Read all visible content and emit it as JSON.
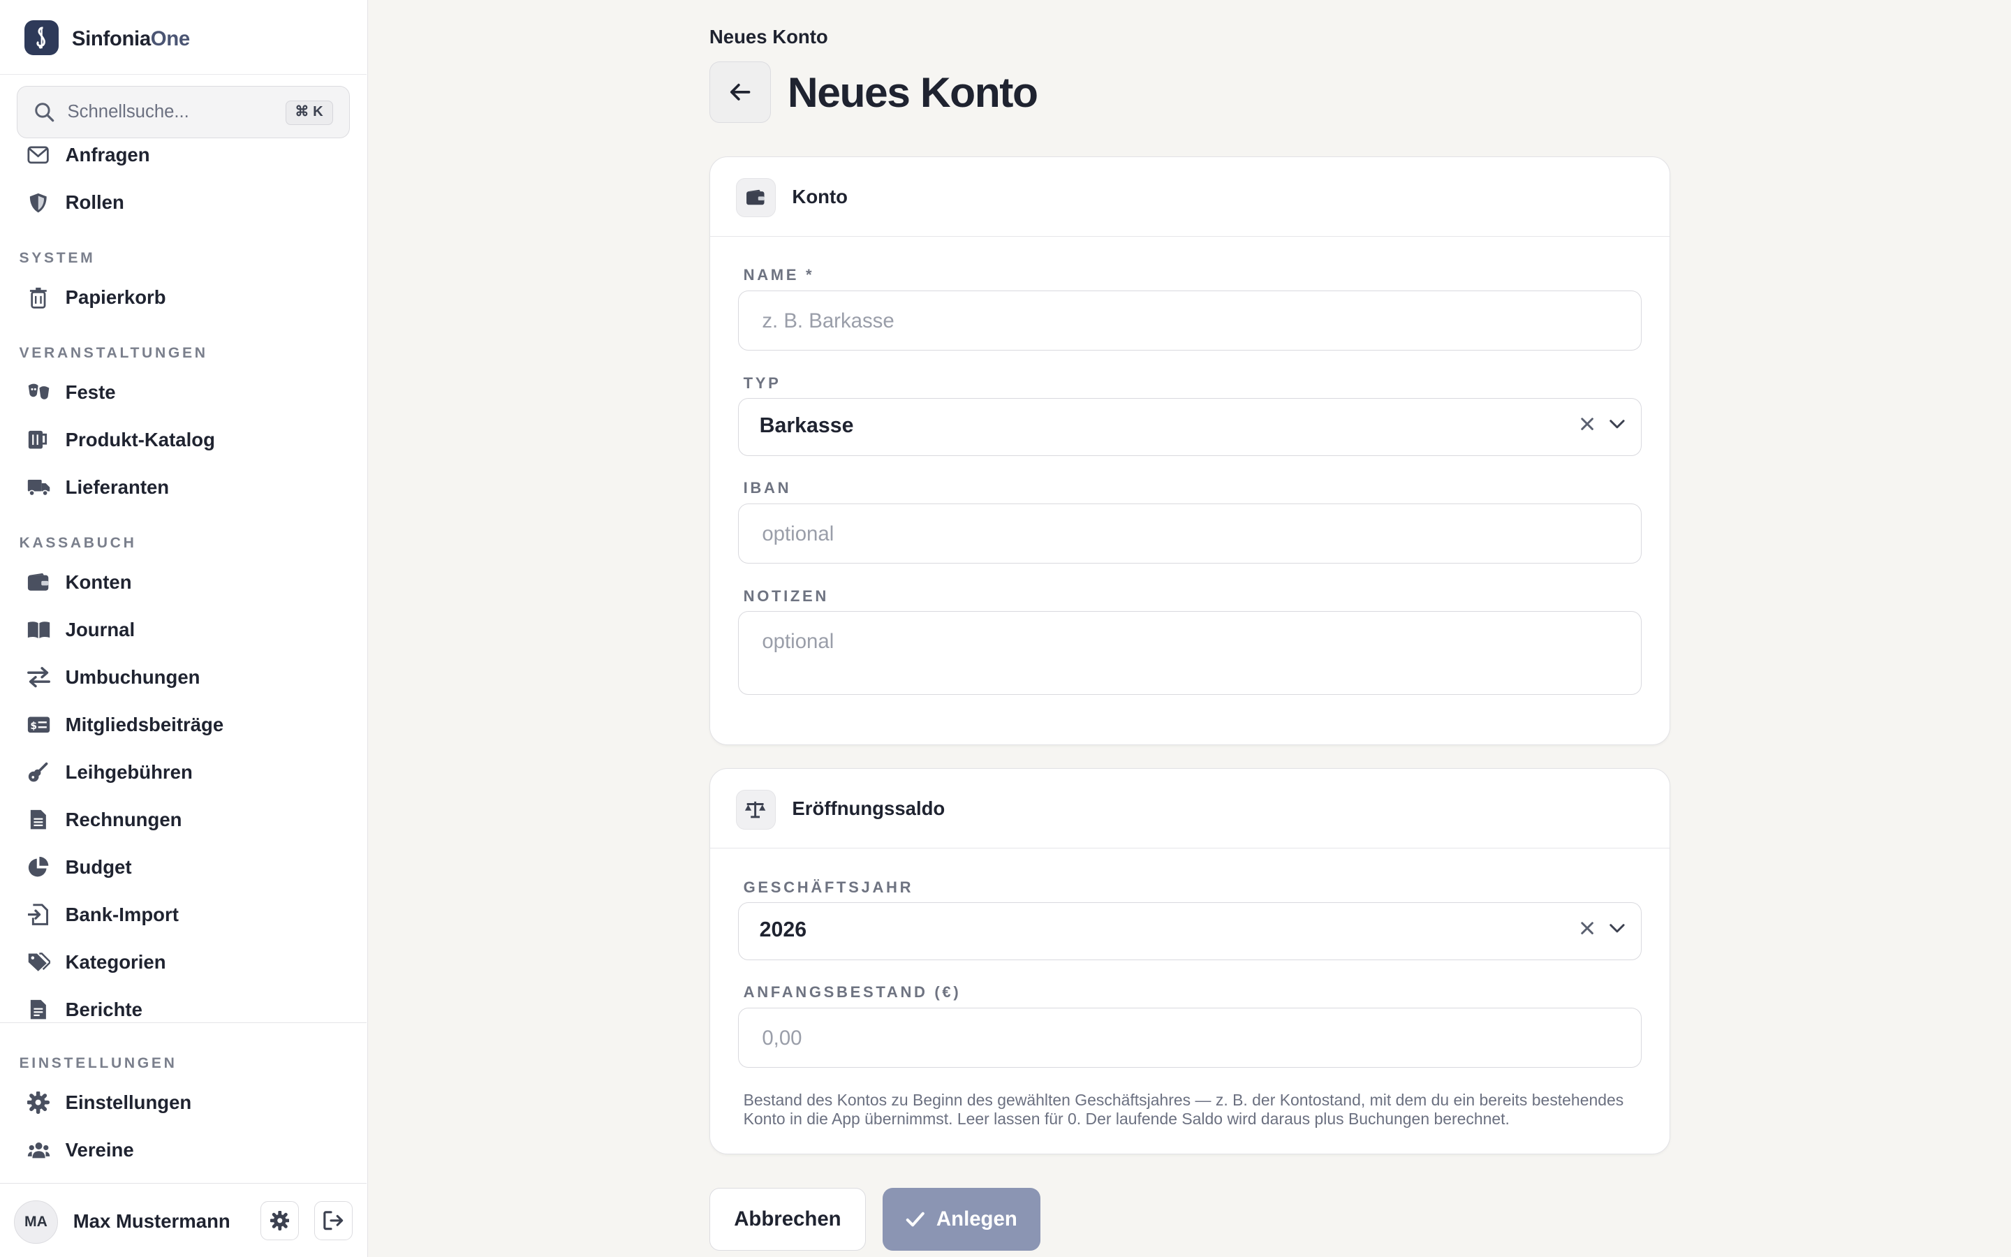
{
  "app": {
    "name_part1": "Sinfonia",
    "name_part2": "One"
  },
  "search": {
    "placeholder": "Schnellsuche...",
    "shortcut": "⌘ K"
  },
  "sidebar": {
    "items_top": [
      {
        "label": "Anfragen",
        "icon": "mail-icon"
      },
      {
        "label": "Rollen",
        "icon": "shield-icon"
      }
    ],
    "sections": [
      {
        "title": "SYSTEM",
        "items": [
          {
            "label": "Papierkorb",
            "icon": "trash-icon"
          }
        ]
      },
      {
        "title": "VERANSTALTUNGEN",
        "items": [
          {
            "label": "Feste",
            "icon": "masks-icon"
          },
          {
            "label": "Produkt-Katalog",
            "icon": "mug-icon"
          },
          {
            "label": "Lieferanten",
            "icon": "truck-icon"
          }
        ]
      },
      {
        "title": "KASSABUCH",
        "items": [
          {
            "label": "Konten",
            "icon": "wallet-icon"
          },
          {
            "label": "Journal",
            "icon": "book-icon"
          },
          {
            "label": "Umbuchungen",
            "icon": "transfer-icon"
          },
          {
            "label": "Mitgliedsbeiträge",
            "icon": "money-card-icon"
          },
          {
            "label": "Leihgebühren",
            "icon": "guitar-icon"
          },
          {
            "label": "Rechnungen",
            "icon": "invoice-icon"
          },
          {
            "label": "Budget",
            "icon": "pie-chart-icon"
          },
          {
            "label": "Bank-Import",
            "icon": "file-import-icon"
          },
          {
            "label": "Kategorien",
            "icon": "tags-icon"
          },
          {
            "label": "Berichte",
            "icon": "report-icon"
          }
        ]
      }
    ],
    "bottom_section": {
      "title": "EINSTELLUNGEN",
      "items": [
        {
          "label": "Einstellungen",
          "icon": "gear-icon"
        },
        {
          "label": "Vereine",
          "icon": "users-icon"
        }
      ]
    },
    "user": {
      "initials": "MA",
      "name": "Max Mustermann"
    }
  },
  "main": {
    "breadcrumb": "Neues Konto",
    "title": "Neues Konto",
    "card_konto": {
      "title": "Konto",
      "fields": {
        "name": {
          "label": "NAME *",
          "placeholder": "z. B. Barkasse"
        },
        "typ": {
          "label": "TYP",
          "value": "Barkasse"
        },
        "iban": {
          "label": "IBAN",
          "placeholder": "optional"
        },
        "notizen": {
          "label": "NOTIZEN",
          "placeholder": "optional"
        }
      }
    },
    "card_saldo": {
      "title": "Eröffnungssaldo",
      "fields": {
        "geschaeftsjahr": {
          "label": "GESCHÄFTSJAHR",
          "value": "2026"
        },
        "anfangsbestand": {
          "label": "ANFANGSBESTAND (€)",
          "placeholder": "0,00"
        }
      },
      "hint": "Bestand des Kontos zu Beginn des gewählten Geschäftsjahres — z. B. der Kontostand, mit dem du ein bereits bestehendes Konto in die App übernimmst. Leer lassen für 0. Der laufende Saldo wird daraus plus Buchungen berechnet."
    },
    "actions": {
      "cancel": "Abbrechen",
      "submit": "Anlegen"
    }
  },
  "colors": {
    "accent": "#2e3a59",
    "submit_disabled": "#8b95b3",
    "background": "#f6f5f2"
  }
}
